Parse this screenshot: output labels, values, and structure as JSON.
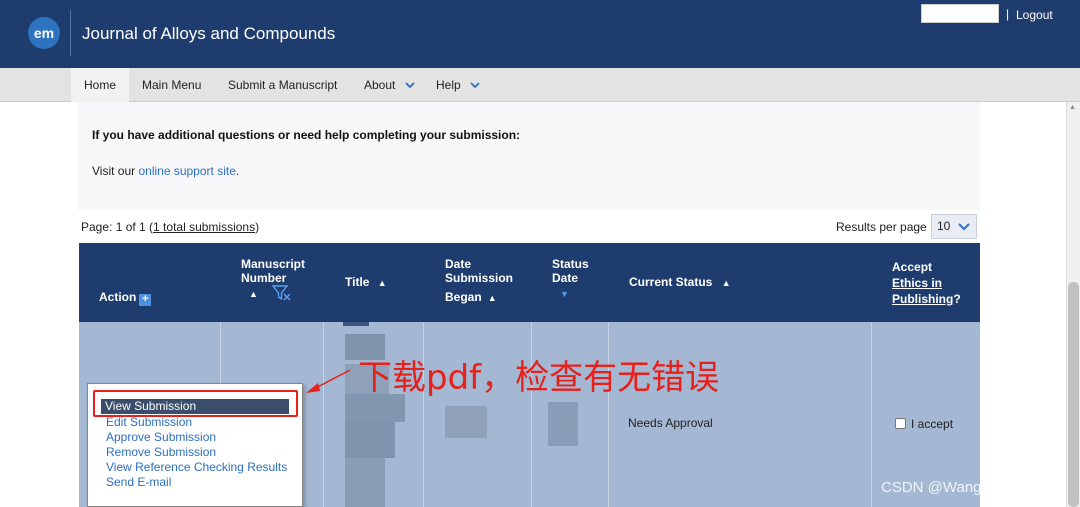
{
  "header": {
    "logo_text": "em",
    "journal_title": "Journal of Alloys and Compounds",
    "separator": "|",
    "logout_label": "Logout",
    "bg_color": "#1e3d6e"
  },
  "nav": {
    "items": [
      {
        "label": "Home"
      },
      {
        "label": "Main Menu"
      },
      {
        "label": "Submit a Manuscript"
      },
      {
        "label": "About",
        "has_dropdown": true
      },
      {
        "label": "Help",
        "has_dropdown": true
      }
    ],
    "chevron": "⌄"
  },
  "help": {
    "question": "If you have additional questions or need help completing your submission:",
    "visit_prefix": "Visit our ",
    "link_text": "online support site",
    "visit_suffix": "."
  },
  "paging": {
    "prefix": "Page: 1 of 1 (",
    "link_text": "1 total submissions",
    "suffix": ")",
    "results_per_page_label": "Results per page",
    "results_per_page_value": "10"
  },
  "table": {
    "headers": {
      "action": "Action",
      "manuscript_l1": "Manuscript",
      "manuscript_l2": "Number",
      "title": "Title",
      "date_l1": "Date",
      "date_l2": "Submission",
      "date_l3": "Began",
      "status_l1": "Status",
      "status_l2": "Date",
      "current_status": "Current Status",
      "accept": "Accept",
      "ethics_l1": "Ethics in",
      "ethics_l2": "Publishing",
      "ethics_q": "?"
    },
    "row": {
      "current_status": "Needs Approval",
      "accept_label": "I accept"
    }
  },
  "action_menu": {
    "items": [
      "View Submission",
      "Edit Submission",
      "Approve Submission",
      "Remove Submission",
      "View Reference Checking Results",
      "Send E-mail"
    ],
    "selected_index": 0
  },
  "annotation": {
    "text": "下载pdf，检查有无错误",
    "color": "#e8201a"
  },
  "watermark": "CSDN @WangUnionpub"
}
